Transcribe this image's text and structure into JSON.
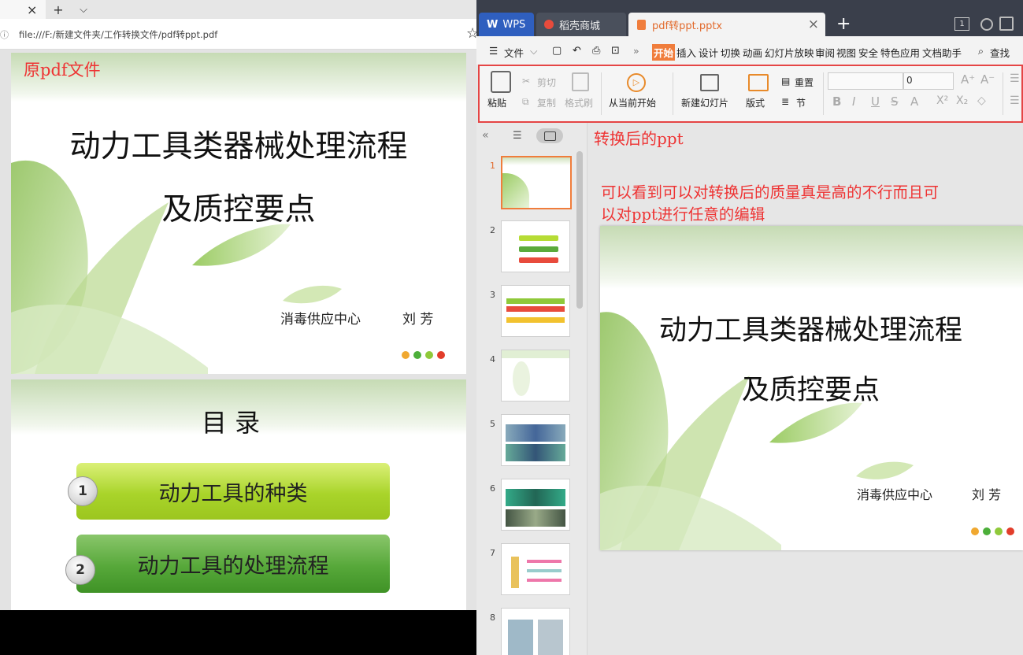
{
  "browser": {
    "tab_close": "×",
    "tab_new": "+",
    "tab_menu": "⌵",
    "info_icon": "ⓘ",
    "url": "file:///F:/新建文件夹/工作转换文件/pdf转ppt.pdf",
    "star": "☆"
  },
  "pdf": {
    "note": "原pdf文件",
    "slide1": {
      "title_line1": "动力工具类器械处理流程",
      "title_line2": "及质控要点",
      "org": "消毒供应中心",
      "author": "刘 芳"
    },
    "slide2": {
      "title": "目    录",
      "items": [
        {
          "num": "1",
          "label": "动力工具的种类"
        },
        {
          "num": "2",
          "label": "动力工具的处理流程"
        }
      ]
    }
  },
  "wps": {
    "tabs": [
      {
        "label": "WPS"
      },
      {
        "label": "稻壳商城"
      },
      {
        "label": "pdf转ppt.pptx"
      }
    ],
    "tab_close": "×",
    "tab_add": "+",
    "badge": "1",
    "menu": {
      "file": "文件",
      "more": "»",
      "items": [
        "开始",
        "插入",
        "设计",
        "切换",
        "动画",
        "幻灯片放映",
        "审阅",
        "视图",
        "安全",
        "特色应用",
        "文档助手"
      ],
      "search": "查找"
    },
    "ribbon": {
      "paste": "粘贴",
      "cut": "剪切",
      "copy": "复制",
      "format_painter": "格式刷",
      "play_from_current": "从当前开始",
      "new_slide": "新建幻灯片",
      "layout": "版式",
      "reset": "重置",
      "section": "节",
      "font_size": "0"
    },
    "panel": {
      "collapse": "«",
      "slide_numbers": [
        "1",
        "2",
        "3",
        "4",
        "5",
        "6",
        "7",
        "8"
      ]
    },
    "notes": {
      "converted": "转换后的ppt",
      "comment_line1": "可以看到可以对转换后的质量真是高的不行而且可",
      "comment_line2": "以对ppt进行任意的编辑"
    },
    "slide": {
      "title_line1": "动力工具类器械处理流程",
      "title_line2": "及质控要点",
      "org": "消毒供应中心",
      "author": "刘 芳"
    }
  },
  "colors": {
    "accent_red": "#ee3333",
    "wps_orange": "#f07d3c",
    "title_bar": "#3a3f4b",
    "dot_orange": "#f0a830",
    "dot_green": "#4caf3a",
    "dot_lime": "#8fc93a",
    "dot_red": "#e23d2a"
  }
}
